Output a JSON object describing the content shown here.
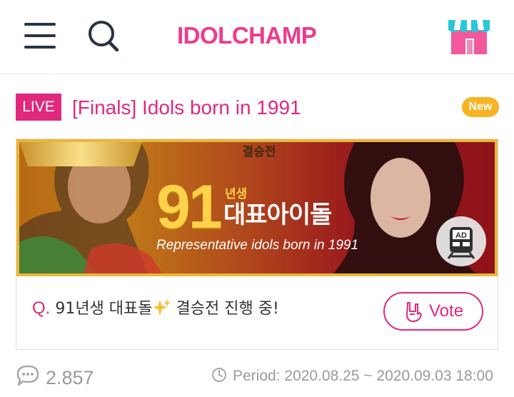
{
  "header": {
    "menu_icon": "hamburger-menu-icon",
    "search_icon": "search-icon",
    "logo_text": "IDOLCHAMP",
    "shop_icon": "shop-icon",
    "brand_color": "#ee3b8d"
  },
  "vote": {
    "live_badge": "LIVE",
    "title": "[Finals] Idols born in 1991",
    "new_badge": "New",
    "banner": {
      "ribbon": "결승전",
      "number": "91",
      "year_suffix": "년생",
      "headline": "대표아이돌",
      "subtitle": "Representative idols born in 1991",
      "ad_label": "AD"
    },
    "question_prefix": "Q.",
    "question_part1": "91년생 대표돌",
    "question_part2": "결승전 진행 중!",
    "vote_button": "Vote"
  },
  "footer": {
    "comment_count": "2.857",
    "period": "Period: 2020.08.25 ~ 2020.09.03 18:00"
  },
  "colors": {
    "accent": "#e0297e",
    "new_badge": "#f7b422",
    "muted_text": "#9a9a9a"
  }
}
